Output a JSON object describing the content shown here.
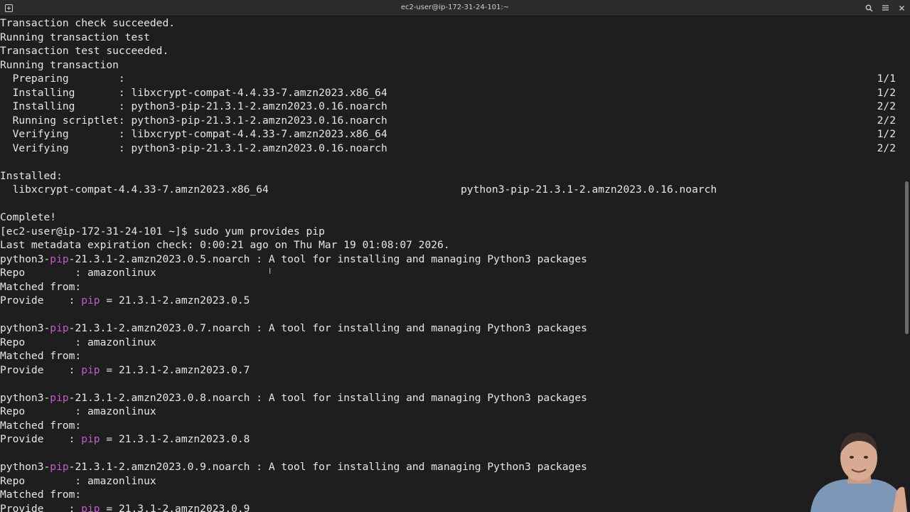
{
  "window": {
    "title": "ec2-user@ip-172-31-24-101:~",
    "new_tab_icon": "new-tab-icon",
    "search_icon": "search-icon",
    "menu_icon": "hamburger-menu-icon",
    "close_icon": "close-icon"
  },
  "terminal": {
    "lines": [
      {
        "text": "Transaction check succeeded.",
        "right": ""
      },
      {
        "text": "Running transaction test",
        "right": ""
      },
      {
        "text": "Transaction test succeeded.",
        "right": ""
      },
      {
        "text": "Running transaction",
        "right": ""
      },
      {
        "text": "  Preparing        :",
        "right": "1/1"
      },
      {
        "text": "  Installing       : libxcrypt-compat-4.4.33-7.amzn2023.x86_64",
        "right": "1/2"
      },
      {
        "text": "  Installing       : python3-pip-21.3.1-2.amzn2023.0.16.noarch",
        "right": "2/2"
      },
      {
        "text": "  Running scriptlet: python3-pip-21.3.1-2.amzn2023.0.16.noarch",
        "right": "2/2"
      },
      {
        "text": "  Verifying        : libxcrypt-compat-4.4.33-7.amzn2023.x86_64",
        "right": "1/2"
      },
      {
        "text": "  Verifying        : python3-pip-21.3.1-2.amzn2023.0.16.noarch",
        "right": "2/2"
      },
      {
        "text": "",
        "right": ""
      },
      {
        "text": "Installed:",
        "right": ""
      },
      {
        "text": "  libxcrypt-compat-4.4.33-7.amzn2023.x86_64",
        "col2": "python3-pip-21.3.1-2.amzn2023.0.16.noarch"
      },
      {
        "text": "",
        "right": ""
      },
      {
        "text": "Complete!",
        "right": ""
      },
      {
        "text": "[ec2-user@ip-172-31-24-101 ~]$ sudo yum provides pip",
        "right": ""
      },
      {
        "text": "Last metadata expiration check: 0:00:21 ago on Thu Mar 19 01:08:07 2026.",
        "right": ""
      },
      {
        "pre": "python3-",
        "hl": "pip",
        "post": "-21.3.1-2.amzn2023.0.5.noarch : A tool for installing and managing Python3 packages"
      },
      {
        "text": "Repo        : amazonlinux",
        "right": ""
      },
      {
        "text": "Matched from:",
        "right": ""
      },
      {
        "pre": "Provide    : ",
        "hl": "pip",
        "post": " = 21.3.1-2.amzn2023.0.5"
      },
      {
        "text": "",
        "right": ""
      },
      {
        "pre": "python3-",
        "hl": "pip",
        "post": "-21.3.1-2.amzn2023.0.7.noarch : A tool for installing and managing Python3 packages"
      },
      {
        "text": "Repo        : amazonlinux",
        "right": ""
      },
      {
        "text": "Matched from:",
        "right": ""
      },
      {
        "pre": "Provide    : ",
        "hl": "pip",
        "post": " = 21.3.1-2.amzn2023.0.7"
      },
      {
        "text": "",
        "right": ""
      },
      {
        "pre": "python3-",
        "hl": "pip",
        "post": "-21.3.1-2.amzn2023.0.8.noarch : A tool for installing and managing Python3 packages"
      },
      {
        "text": "Repo        : amazonlinux",
        "right": ""
      },
      {
        "text": "Matched from:",
        "right": ""
      },
      {
        "pre": "Provide    : ",
        "hl": "pip",
        "post": " = 21.3.1-2.amzn2023.0.8"
      },
      {
        "text": "",
        "right": ""
      },
      {
        "pre": "python3-",
        "hl": "pip",
        "post": "-21.3.1-2.amzn2023.0.9.noarch : A tool for installing and managing Python3 packages"
      },
      {
        "text": "Repo        : amazonlinux",
        "right": ""
      },
      {
        "text": "Matched from:",
        "right": ""
      },
      {
        "pre": "Provide    : ",
        "hl": "pip",
        "post": " = 21.3.1-2.amzn2023.0.9"
      }
    ]
  },
  "colors": {
    "background": "#1e1e1e",
    "foreground": "#e6e6e6",
    "match_highlight": "#c15ec8"
  }
}
